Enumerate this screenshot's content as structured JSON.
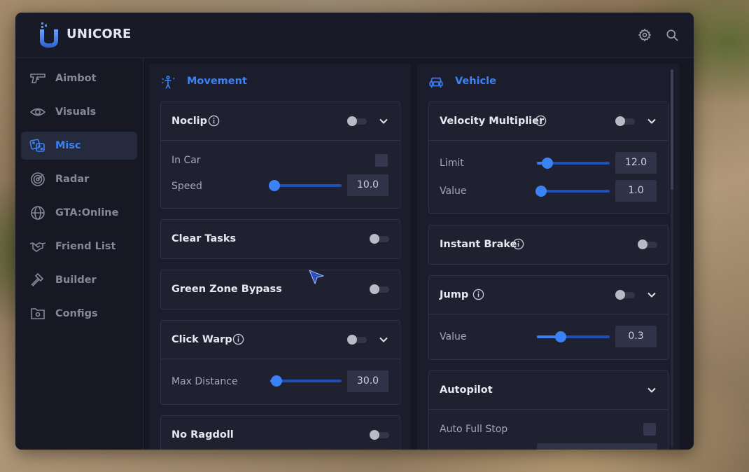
{
  "app": {
    "title": "UNICORE"
  },
  "header": {
    "icons": [
      "gear-icon",
      "search-icon"
    ]
  },
  "sidebar": {
    "items": [
      {
        "label": "Aimbot",
        "icon": "pistol-icon",
        "active": false
      },
      {
        "label": "Visuals",
        "icon": "eye-icon",
        "active": false
      },
      {
        "label": "Misc",
        "icon": "dice-icon",
        "active": true
      },
      {
        "label": "Radar",
        "icon": "radar-icon",
        "active": false
      },
      {
        "label": "GTA:Online",
        "icon": "globe-icon",
        "active": false
      },
      {
        "label": "Friend List",
        "icon": "handshake-icon",
        "active": false
      },
      {
        "label": "Builder",
        "icon": "hammer-icon",
        "active": false
      },
      {
        "label": "Configs",
        "icon": "folder-gear-icon",
        "active": false
      }
    ]
  },
  "colors": {
    "accent": "#3b82f6",
    "window_bg": "#161723",
    "card_bg": "#1f2030"
  },
  "movement": {
    "title": "Movement",
    "icon": "person-jump-icon",
    "noclip": {
      "title": "Noclip",
      "enabled": false,
      "expanded": true,
      "in_car_label": "In Car",
      "in_car_checked": false,
      "speed_label": "Speed",
      "speed_value": "10.0",
      "speed_level": 0.06
    },
    "clear_tasks": {
      "title": "Clear Tasks",
      "enabled": false
    },
    "green_zone_bypass": {
      "title": "Green Zone Bypass",
      "enabled": false
    },
    "click_warp": {
      "title": "Click Warp",
      "enabled": false,
      "expanded": true,
      "max_distance_label": "Max Distance",
      "max_distance_value": "30.0",
      "max_distance_level": 0.09
    },
    "no_ragdoll": {
      "title": "No Ragdoll",
      "enabled": false
    }
  },
  "vehicle": {
    "title": "Vehicle",
    "icon": "car-icon",
    "velocity_multiplier": {
      "title": "Velocity Multiplier",
      "enabled": false,
      "expanded": true,
      "limit_label": "Limit",
      "limit_value": "12.0",
      "limit_level": 0.14,
      "value_label": "Value",
      "value_value": "1.0",
      "value_level": 0.06
    },
    "instant_brake": {
      "title": "Instant Brake",
      "enabled": false
    },
    "jump": {
      "title": "Jump",
      "enabled": false,
      "expanded": true,
      "value_label": "Value",
      "value_value": "0.3",
      "value_level": 0.33
    },
    "autopilot": {
      "title": "Autopilot",
      "expanded": true,
      "auto_full_stop_label": "Auto Full Stop",
      "auto_full_stop_checked": false
    }
  }
}
